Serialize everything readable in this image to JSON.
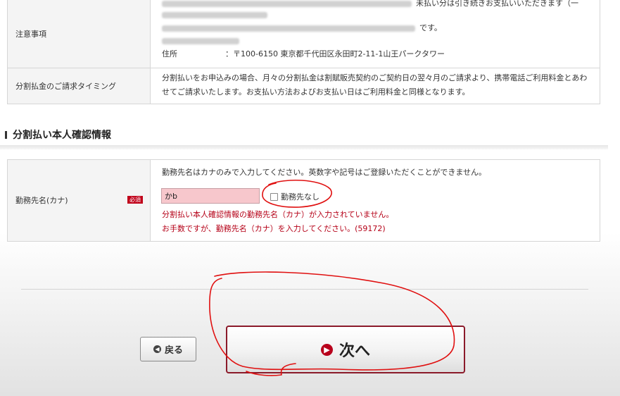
{
  "notes": {
    "label": "注意事項",
    "line1_suffix": "未払い分は引き続きお支払いいただきます（一",
    "line3_suffix": "です。",
    "address_label": "住所",
    "address_value": "：〒100-6150 東京都千代田区永田町2-11-1山王パークタワー"
  },
  "timing": {
    "label": "分割払金のご請求タイミング",
    "text": "分割払いをお申込みの場合、月々の分割払金は割賦販売契約のご契約日の翌々月のご請求より、携帯電話ご利用料金とあわせてご請求いたします。お支払い方法およびお支払い日はご利用料金と同様となります。"
  },
  "section": {
    "heading": "分割払い本人確認情報"
  },
  "employer": {
    "label": "勤務先名(カナ)",
    "required_badge": "必須",
    "instruction": "勤務先名はカナのみで入力してください。英数字や記号はご登録いただくことができません。",
    "input_value": "かb",
    "checkbox_label": "勤務先なし",
    "checkbox_checked": false,
    "error_line1": "分割払い本人確認情報の勤務先名（カナ）が入力されていません。",
    "error_line2": "お手数ですが、勤務先名（カナ）を入力してください。(59172)"
  },
  "buttons": {
    "back_label": "戻る",
    "next_label": "次へ"
  },
  "colors": {
    "required_red": "#c0001a",
    "error_text": "#b50017",
    "input_error_bg": "#f7c7cc",
    "next_button_border": "#8b1a2a",
    "annotation_red": "#e01010"
  },
  "icons": {
    "back": "arrow-left-circle-icon",
    "next": "arrow-right-circle-icon"
  }
}
